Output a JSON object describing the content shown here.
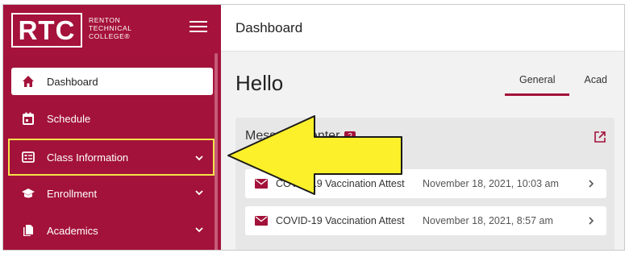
{
  "sidebar": {
    "logo": {
      "mark": "RTC",
      "line1": "RENTON",
      "line2": "TECHNICAL",
      "line3": "COLLEGE®"
    },
    "menu_icon": "hamburger-icon",
    "items": [
      {
        "label": "Dashboard",
        "icon": "home-icon"
      },
      {
        "label": "Schedule",
        "icon": "calendar-icon"
      },
      {
        "label": "Class Information",
        "icon": "id-card-icon"
      },
      {
        "label": "Enrollment",
        "icon": "graduation-cap-icon"
      },
      {
        "label": "Academics",
        "icon": "document-icon"
      }
    ]
  },
  "header": {
    "title": "Dashboard"
  },
  "main": {
    "greeting": "Hello",
    "tabs": [
      {
        "label": "General"
      },
      {
        "label": "Acad"
      }
    ],
    "message_center": {
      "title": "Message Center",
      "badge": "2",
      "messages": [
        {
          "subject": "COVID-19 Vaccination Attest",
          "date": "November 18, 2021, 10:03 am"
        },
        {
          "subject": "COVID-19 Vaccination Attest",
          "date": "November 18, 2021, 8:57 am"
        }
      ]
    }
  },
  "colors": {
    "brand": "#a3123a",
    "highlight": "#f3e34a",
    "arrow": "#fbf02a"
  }
}
